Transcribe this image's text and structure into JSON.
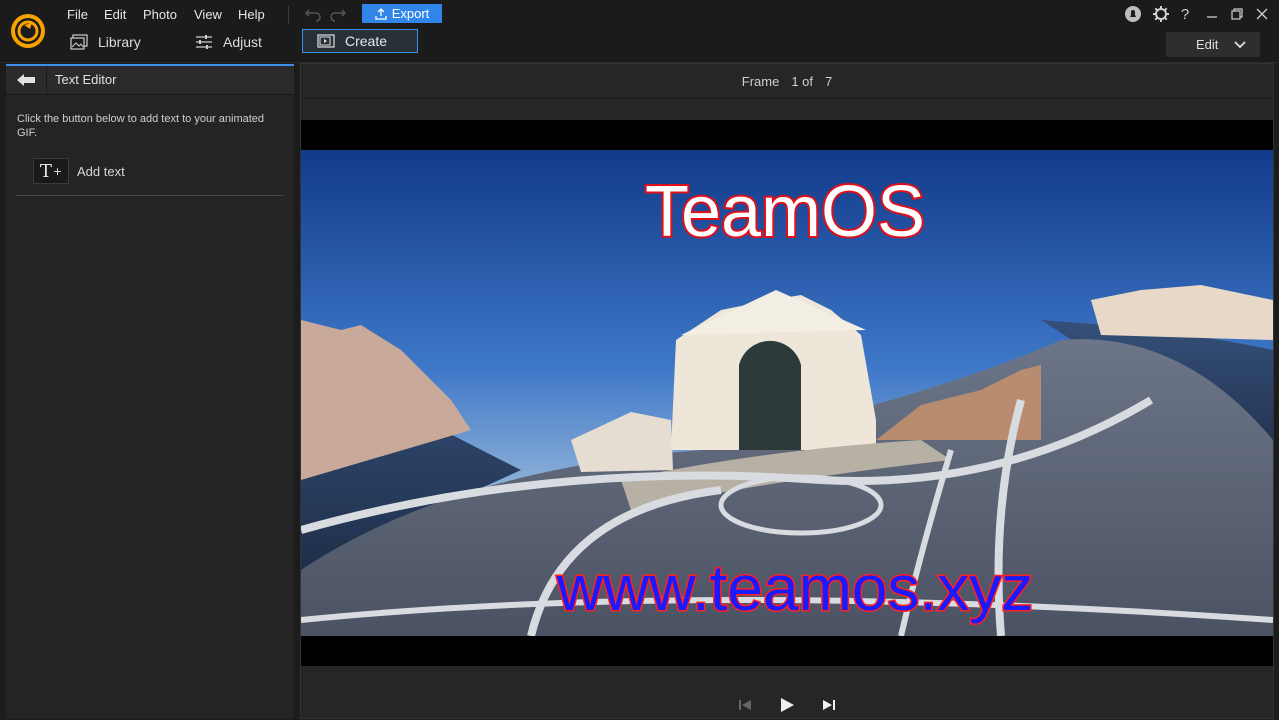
{
  "menu": {
    "file": "File",
    "edit": "Edit",
    "photo": "Photo",
    "view": "View",
    "help": "Help"
  },
  "toolbar": {
    "export_label": "Export"
  },
  "modes": {
    "library": "Library",
    "adjust": "Adjust",
    "create": "Create"
  },
  "edit_dropdown": {
    "selected": "Edit"
  },
  "panel": {
    "title": "Text Editor",
    "instructions": "Click the button below to add text to your animated GIF.",
    "add_text_label": "Add text"
  },
  "frame": {
    "label": "Frame",
    "current": "1 of",
    "total": "7"
  },
  "image": {
    "title_text": "TeamOS",
    "url_text": "www.teamos.xyz"
  },
  "colors": {
    "accent": "#2f86e8",
    "title_fill": "#ffffff",
    "title_stroke": "#e0101a",
    "url_fill": "#1a1aff",
    "url_stroke": "#ff2020"
  },
  "icons": {
    "logo": "app-logo-icon",
    "undo": "undo-icon",
    "redo": "redo-icon",
    "export": "export-icon",
    "library": "library-icon",
    "adjust": "adjust-icon",
    "create": "create-icon",
    "notify": "notification-icon",
    "settings": "settings-icon",
    "help": "help-icon",
    "minimize": "minimize-icon",
    "restore": "restore-icon",
    "close": "close-icon",
    "back": "back-arrow-icon",
    "prev": "previous-frame-icon",
    "play": "play-icon",
    "next": "next-frame-icon"
  }
}
